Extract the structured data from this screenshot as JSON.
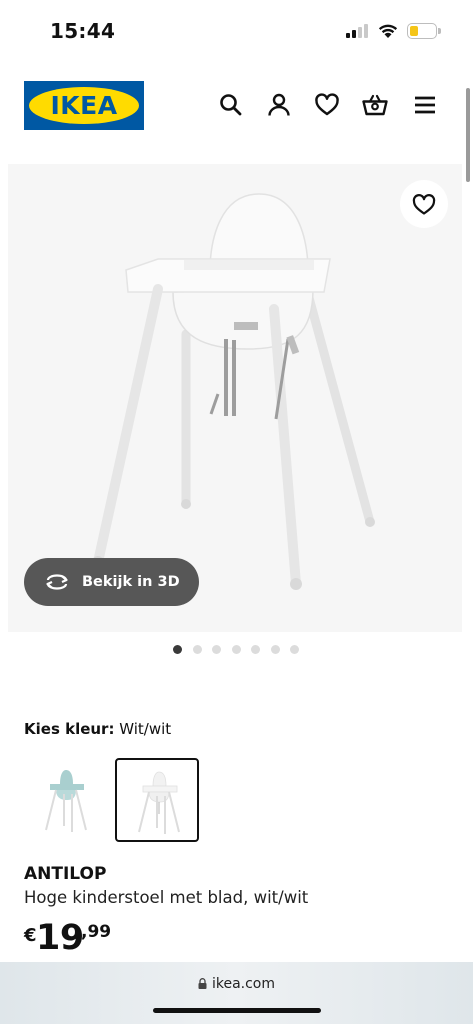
{
  "status_bar": {
    "time": "15:44"
  },
  "header": {
    "logo_text": "IKEA",
    "colors": {
      "logo_blue": "#0058a3",
      "logo_yellow": "#ffdb00"
    },
    "icons": [
      "search-icon",
      "user-icon",
      "heart-icon",
      "basket-icon",
      "menu-icon"
    ]
  },
  "gallery": {
    "view_3d_label": "Bekijk in 3D",
    "dots_total": 7,
    "dots_active": 1
  },
  "color_chooser": {
    "label": "Kies kleur:",
    "value": "Wit/wit",
    "options": [
      {
        "name": "light-blue-chair-thumbnail",
        "color": "#a9cfcf",
        "selected": false
      },
      {
        "name": "white-chair-thumbnail",
        "color": "#f2f2f2",
        "selected": true
      }
    ]
  },
  "product": {
    "name": "ANTILOP",
    "description": "Hoge kinderstoel met blad, wit/wit",
    "price_currency": "€",
    "price_int": "19",
    "price_dec": ",99"
  },
  "browser": {
    "url": "ikea.com"
  }
}
